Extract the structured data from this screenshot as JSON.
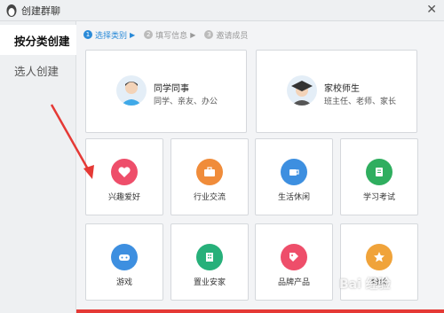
{
  "window": {
    "title": "创建群聊",
    "close_glyph": "✕"
  },
  "sidebar": {
    "items": [
      {
        "label": "按分类创建",
        "active": true
      },
      {
        "label": "选人创建",
        "active": false
      }
    ]
  },
  "steps": [
    {
      "num": "1",
      "label": "选择类别",
      "active": true
    },
    {
      "num": "2",
      "label": "填写信息",
      "active": false
    },
    {
      "num": "3",
      "label": "邀请成员",
      "active": false
    }
  ],
  "big_categories": [
    {
      "title": "同学同事",
      "subtitle": "同学、亲友、办公",
      "icon": "person-avatar-icon"
    },
    {
      "title": "家校师生",
      "subtitle": "班主任、老师、家长",
      "icon": "graduation-cap-icon"
    }
  ],
  "categories": [
    {
      "label": "兴趣爱好",
      "icon": "heart-icon",
      "color": "#ee4e6a"
    },
    {
      "label": "行业交流",
      "icon": "briefcase-icon",
      "color": "#f08c3a"
    },
    {
      "label": "生活休闲",
      "icon": "coffee-cup-icon",
      "color": "#3d8fe0"
    },
    {
      "label": "学习考试",
      "icon": "book-icon",
      "color": "#2fae5f"
    },
    {
      "label": "游戏",
      "icon": "gamepad-icon",
      "color": "#3d8fe0"
    },
    {
      "label": "置业安家",
      "icon": "building-icon",
      "color": "#27b07a"
    },
    {
      "label": "品牌产品",
      "icon": "tag-icon",
      "color": "#ee4e6a"
    },
    {
      "label": "粉丝",
      "icon": "star-icon",
      "color": "#f0a33a"
    }
  ],
  "watermark": "Bai 经验",
  "annotation_arrow_color": "#e53935"
}
